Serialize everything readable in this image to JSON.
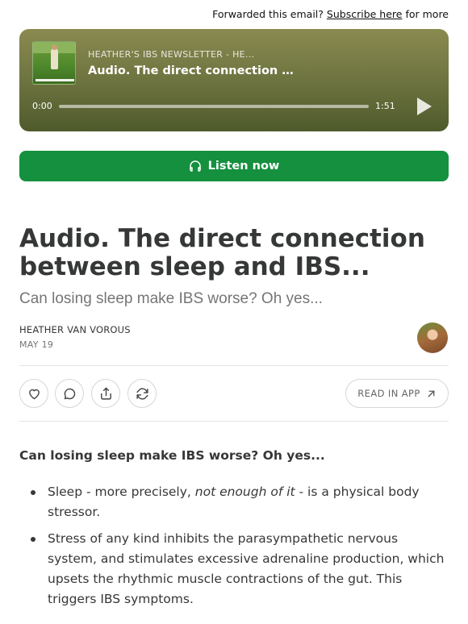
{
  "forward": {
    "prefix": "Forwarded this email?",
    "link": "Subscribe here",
    "suffix": "for more"
  },
  "player": {
    "show_title": "HEATHER'S IBS NEWSLETTER - HE...",
    "episode_title": "Audio. The direct connection …",
    "time_elapsed": "0:00",
    "time_total": "1:51",
    "progress": 0
  },
  "listen_button": {
    "label": "Listen now"
  },
  "post": {
    "title": "Audio. The direct connection between sleep and IBS...",
    "subtitle": "Can losing sleep make IBS worse? Oh yes...",
    "author": "HEATHER VAN VOROUS",
    "date": "MAY 19"
  },
  "actions": {
    "read_in_app": "READ IN APP"
  },
  "body": {
    "lead": "Can losing sleep make IBS worse? Oh yes...",
    "bullet1_pre": "Sleep - more precisely, ",
    "bullet1_em": "not enough of it",
    "bullet1_post": " - is a physical body stressor.",
    "bullet2": "Stress of any kind inhibits the parasympathetic nervous system, and stimulates excessive adrenaline production, which upsets the rhythmic muscle contractions of the gut. This triggers IBS symptoms."
  },
  "colors": {
    "accent_green": "#14903e",
    "player_top": "#8a8a50",
    "player_bottom": "#4f5a2c"
  }
}
